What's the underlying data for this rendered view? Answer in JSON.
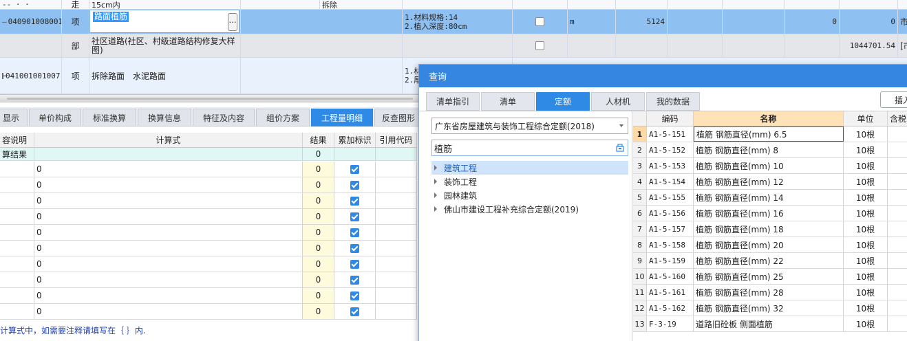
{
  "top_grid": {
    "row0": {
      "dash": "-- · ·",
      "unit": "走",
      "name": "15cm内",
      "extra": "拆除"
    },
    "row1": {
      "code": "040901008001",
      "type": "项",
      "name": "路面植筋",
      "features": [
        "1.材料规格:14",
        "2.植入深度:80cm"
      ],
      "unit": "m",
      "qty": "5124",
      "v1": "0",
      "v2": "0",
      "tail": "市"
    },
    "row2": {
      "type": "部",
      "name": "社区道路(社区、村级道路结构修复大样图)",
      "v2": "1044701.54",
      "tail": "[市"
    },
    "row3": {
      "code": "041001001007",
      "type": "项",
      "name": "拆除路面　水泥路面",
      "features": [
        "1.材",
        "2.厚"
      ]
    },
    "ellipsis": "…"
  },
  "bottom_tabs": [
    "显示",
    "单价构成",
    "标准换算",
    "换算信息",
    "特征及内容",
    "组价方案",
    "工程量明细",
    "反查图形"
  ],
  "bottom_active_tab": "工程量明细",
  "qty_grid": {
    "headers": {
      "desc": "容说明",
      "formula": "计算式",
      "result": "结果",
      "accum": "累加标识",
      "ref": "引用代码"
    },
    "result_row": {
      "desc": "算结果",
      "result": "0"
    },
    "rows": [
      {
        "formula": "0",
        "result": "0",
        "checked": true
      },
      {
        "formula": "0",
        "result": "0",
        "checked": true
      },
      {
        "formula": "0",
        "result": "0",
        "checked": true
      },
      {
        "formula": "0",
        "result": "0",
        "checked": true
      },
      {
        "formula": "0",
        "result": "0",
        "checked": true
      },
      {
        "formula": "0",
        "result": "0",
        "checked": true
      },
      {
        "formula": "0",
        "result": "0",
        "checked": true
      },
      {
        "formula": "0",
        "result": "0",
        "checked": true
      },
      {
        "formula": "0",
        "result": "0",
        "checked": true
      },
      {
        "formula": "0",
        "result": "0",
        "checked": true
      }
    ],
    "hint": "计算式中，如需要注释请填写在｛ ｝内."
  },
  "dialog": {
    "title": "查询",
    "tabs": [
      "清单指引",
      "清单",
      "定额",
      "人材机",
      "我的数据"
    ],
    "active_tab": "定额",
    "insert_label": "插入",
    "library": "广东省房屋建筑与装饰工程综合定额(2018)",
    "search_value": "植筋",
    "tree": [
      "建筑工程",
      "装饰工程",
      "园林建筑",
      "佛山市建设工程补充综合定额(2019)"
    ],
    "selected_tree": "建筑工程",
    "headers": {
      "code": "编码",
      "name": "名称",
      "unit": "单位",
      "content": "含税"
    },
    "rows": [
      {
        "idx": "1",
        "code": "A1-5-151",
        "name": "植筋 钢筋直径(mm) 6.5",
        "unit": "10根"
      },
      {
        "idx": "2",
        "code": "A1-5-152",
        "name": "植筋 钢筋直径(mm) 8",
        "unit": "10根"
      },
      {
        "idx": "3",
        "code": "A1-5-153",
        "name": "植筋 钢筋直径(mm) 10",
        "unit": "10根"
      },
      {
        "idx": "4",
        "code": "A1-5-154",
        "name": "植筋 钢筋直径(mm) 12",
        "unit": "10根"
      },
      {
        "idx": "5",
        "code": "A1-5-155",
        "name": "植筋 钢筋直径(mm) 14",
        "unit": "10根"
      },
      {
        "idx": "6",
        "code": "A1-5-156",
        "name": "植筋 钢筋直径(mm) 16",
        "unit": "10根"
      },
      {
        "idx": "7",
        "code": "A1-5-157",
        "name": "植筋 钢筋直径(mm) 18",
        "unit": "10根"
      },
      {
        "idx": "8",
        "code": "A1-5-158",
        "name": "植筋 钢筋直径(mm) 20",
        "unit": "10根"
      },
      {
        "idx": "9",
        "code": "A1-5-159",
        "name": "植筋 钢筋直径(mm) 22",
        "unit": "10根"
      },
      {
        "idx": "10",
        "code": "A1-5-160",
        "name": "植筋 钢筋直径(mm) 25",
        "unit": "10根"
      },
      {
        "idx": "11",
        "code": "A1-5-161",
        "name": "植筋 钢筋直径(mm) 28",
        "unit": "10根"
      },
      {
        "idx": "12",
        "code": "A1-5-162",
        "name": "植筋 钢筋直径(mm) 32",
        "unit": "10根"
      },
      {
        "idx": "13",
        "code": "F-3-19",
        "name": "道路旧砼板 侧面植筋",
        "unit": "10根"
      }
    ]
  },
  "colors": {
    "accent": "#2f8ae5",
    "selected_row": "#8fc0f2",
    "title_bar": "#3486e0",
    "name_header": "#ffe2b8"
  }
}
